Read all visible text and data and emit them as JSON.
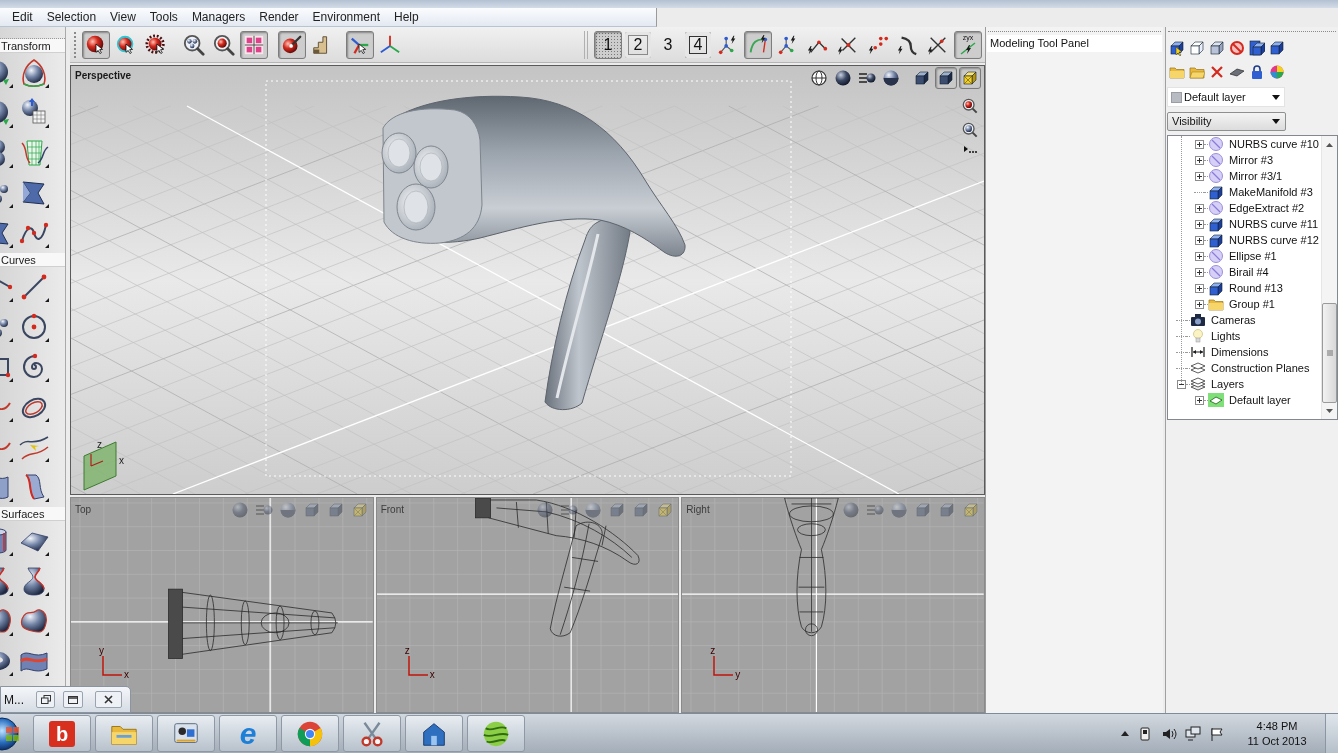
{
  "menu": [
    "Edit",
    "Selection",
    "View",
    "Tools",
    "Managers",
    "Render",
    "Environment",
    "Help"
  ],
  "tool_panel": {
    "sections": [
      {
        "title": "Transform"
      },
      {
        "title": "Curves"
      },
      {
        "title": "Surfaces"
      }
    ]
  },
  "toolbar": {
    "left_groups": [
      [
        {
          "kind": "select",
          "selected": true
        },
        {
          "kind": "pick",
          "selected": false
        },
        {
          "kind": "gear",
          "selected": false
        }
      ],
      [
        {
          "kind": "zoomall",
          "selected": false
        },
        {
          "kind": "zoom",
          "selected": false
        },
        {
          "kind": "grid",
          "selected": true
        }
      ],
      [
        {
          "kind": "paint",
          "selected": true
        },
        {
          "kind": "steps",
          "selected": false
        }
      ],
      [
        {
          "kind": "move",
          "selected": true
        },
        {
          "kind": "axes",
          "selected": false
        }
      ]
    ],
    "right_group": [
      {
        "kind": "single",
        "label": "1",
        "selected": true
      },
      {
        "kind": "split",
        "label": "2",
        "selected": false
      },
      {
        "kind": "triple",
        "label": "3",
        "selected": false
      },
      {
        "kind": "quad",
        "label": "4",
        "selected": false
      },
      {
        "kind": "points",
        "selected": false
      },
      {
        "kind": "arc",
        "selected": true
      },
      {
        "kind": "points",
        "selected": false
      },
      {
        "kind": "segment",
        "selected": false
      },
      {
        "kind": "cross",
        "selected": false
      },
      {
        "kind": "dots",
        "selected": false
      },
      {
        "kind": "bend",
        "selected": false
      },
      {
        "kind": "trim",
        "selected": false
      },
      {
        "kind": "frame",
        "label": "zyx",
        "selected": true
      }
    ]
  },
  "perspective": {
    "title": "Perspective",
    "display_buttons": [
      {
        "kind": "globe",
        "selected": false
      },
      {
        "kind": "sphere",
        "selected": false
      },
      {
        "kind": "lines",
        "selected": false
      },
      {
        "kind": "half",
        "selected": false
      },
      {
        "kind": "cube",
        "selected": false
      },
      {
        "kind": "cube",
        "selected": true
      },
      {
        "kind": "wire",
        "selected": true
      }
    ],
    "axes": [
      "z",
      "x"
    ]
  },
  "views": [
    {
      "kind": "top",
      "title": "Top",
      "axes": [
        "y",
        "x"
      ]
    },
    {
      "kind": "front",
      "title": "Front",
      "axes": [
        "z",
        "x"
      ]
    },
    {
      "kind": "right",
      "title": "Right",
      "axes": [
        "z",
        "y"
      ]
    }
  ],
  "modeling_panel": {
    "title": "Modeling Tool Panel"
  },
  "scene_panel": {
    "layer_select": {
      "value": "Default layer"
    },
    "mode_select": {
      "value": "Visibility"
    },
    "tree": {
      "partial_branch": [
        {
          "label": "NURBS curve #10",
          "kind": "curve",
          "expandable": true,
          "expanded": false
        },
        {
          "label": "Mirror #3",
          "kind": "curve",
          "expandable": true,
          "expanded": false
        },
        {
          "label": "Mirror #3/1",
          "kind": "curve",
          "expandable": true,
          "expanded": false
        },
        {
          "label": "MakeManifold #3",
          "kind": "solid",
          "expandable": false
        },
        {
          "label": "EdgeExtract #2",
          "kind": "curve",
          "expandable": true,
          "expanded": false
        },
        {
          "label": "NURBS curve #11",
          "kind": "solid",
          "expandable": true,
          "expanded": false
        },
        {
          "label": "NURBS curve #12",
          "kind": "solid",
          "expandable": true,
          "expanded": false
        },
        {
          "label": "Ellipse #1",
          "kind": "curve",
          "expandable": true,
          "expanded": false
        },
        {
          "label": "Birail #4",
          "kind": "curve",
          "expandable": true,
          "expanded": false
        },
        {
          "label": "Round #13",
          "kind": "solid",
          "expandable": true,
          "expanded": false
        },
        {
          "label": "Group #1",
          "kind": "folder",
          "expandable": true,
          "expanded": false
        }
      ],
      "items": [
        {
          "label": "Cameras",
          "kind": "camera",
          "expandable": false
        },
        {
          "label": "Lights",
          "kind": "light",
          "expandable": false
        },
        {
          "label": "Dimensions",
          "kind": "dimension",
          "expandable": false
        },
        {
          "label": "Construction Planes",
          "kind": "planes",
          "expandable": false
        },
        {
          "label": "Layers",
          "kind": "layers",
          "expandable": true,
          "expanded": true,
          "children": [
            {
              "label": "Default layer",
              "kind": "layer",
              "expandable": true,
              "expanded": false
            }
          ]
        }
      ]
    }
  },
  "minimized_window": {
    "title": "M..."
  },
  "taskbar": {
    "apps": [
      {
        "kind": "logo",
        "label": "b"
      },
      {
        "kind": "folder"
      },
      {
        "kind": "devices"
      },
      {
        "kind": "browser",
        "label": "e"
      },
      {
        "kind": "wheel"
      },
      {
        "kind": "scissors"
      },
      {
        "kind": "house"
      },
      {
        "kind": "ball"
      }
    ],
    "clock": {
      "time": "4:48 PM",
      "date": "11 Oct 2013"
    }
  }
}
